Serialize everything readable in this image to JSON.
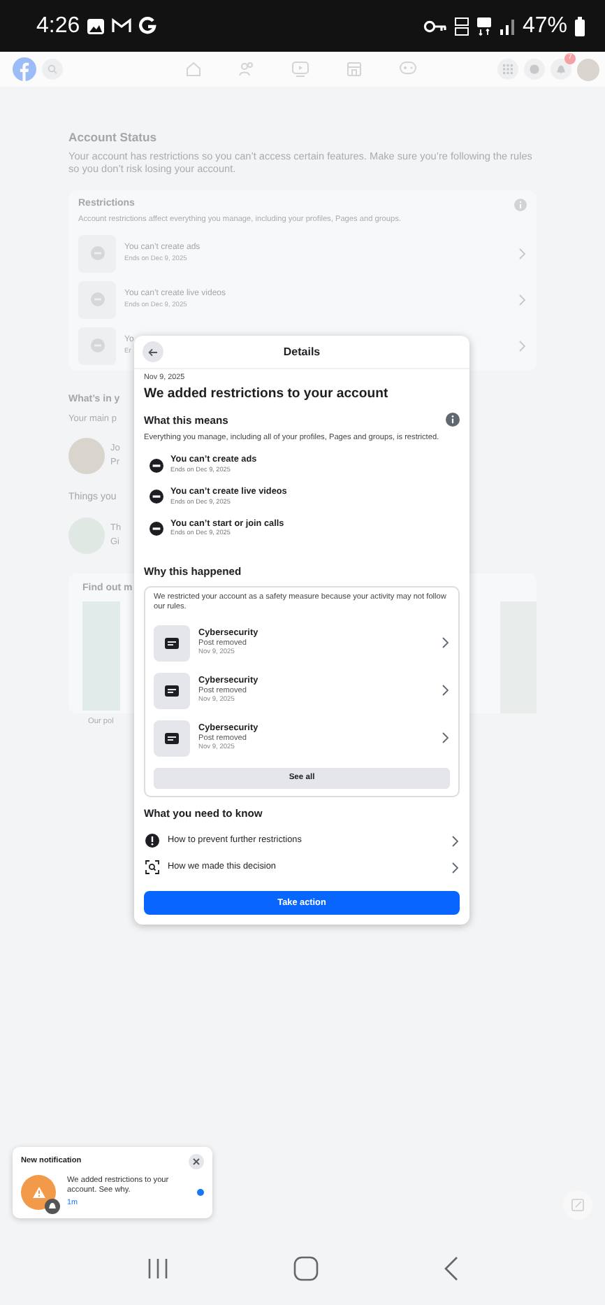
{
  "status_bar": {
    "time": "4:26",
    "battery": "47%"
  },
  "top_nav": {
    "notification_count": "7"
  },
  "account_status": {
    "title": "Account Status",
    "description": "Your account has restrictions so you can’t access certain features. Make sure you’re following the rules so you don’t risk losing your account.",
    "restrictions": {
      "title": "Restrictions",
      "description": "Account restrictions affect everything you manage, including your profiles, Pages and groups.",
      "items": [
        {
          "title": "You can’t create ads",
          "subtitle": "Ends on Dec 9, 2025"
        },
        {
          "title": "You can’t create live videos",
          "subtitle": "Ends on Dec 9, 2025"
        },
        {
          "title": "Yo",
          "subtitle": "Er"
        }
      ]
    },
    "whats_in": {
      "title": "What’s in y",
      "subtitle": "Your main p",
      "item": {
        "title": "Jo",
        "subtitle": "Pr"
      }
    },
    "things": {
      "title": "Things you",
      "item": {
        "title": "Th",
        "subtitle": "Gi"
      }
    },
    "find_out": {
      "title": "Find out m",
      "caption": "Our pol"
    }
  },
  "details": {
    "title": "Details",
    "date": "Nov 9, 2025",
    "heading": "We added restrictions to your account",
    "means": {
      "title": "What this means",
      "description": "Everything you manage, including all of your profiles, Pages and groups, is restricted.",
      "items": [
        {
          "title": "You can’t create ads",
          "subtitle": "Ends on Dec 9, 2025"
        },
        {
          "title": "You can’t create live videos",
          "subtitle": "Ends on Dec 9, 2025"
        },
        {
          "title": "You can’t start or join calls",
          "subtitle": "Ends on Dec 9, 2025"
        }
      ]
    },
    "why": {
      "title": "Why this happened",
      "description": "We restricted your account as a safety measure because your activity may not follow our rules.",
      "items": [
        {
          "title": "Cybersecurity",
          "status": "Post removed",
          "date": "Nov 9, 2025"
        },
        {
          "title": "Cybersecurity",
          "status": "Post removed",
          "date": "Nov 9, 2025"
        },
        {
          "title": "Cybersecurity",
          "status": "Post removed",
          "date": "Nov 9, 2025"
        }
      ],
      "see_all": "See all"
    },
    "know": {
      "title": "What you need to know",
      "links": [
        {
          "kind": "alert",
          "label": "How to prevent further restrictions"
        },
        {
          "kind": "scan",
          "label": "How we made this decision"
        }
      ]
    },
    "action": "Take action"
  },
  "notification": {
    "title": "New notification",
    "message": "We added restrictions to your account. See why.",
    "time": "1m",
    "unread": true
  }
}
